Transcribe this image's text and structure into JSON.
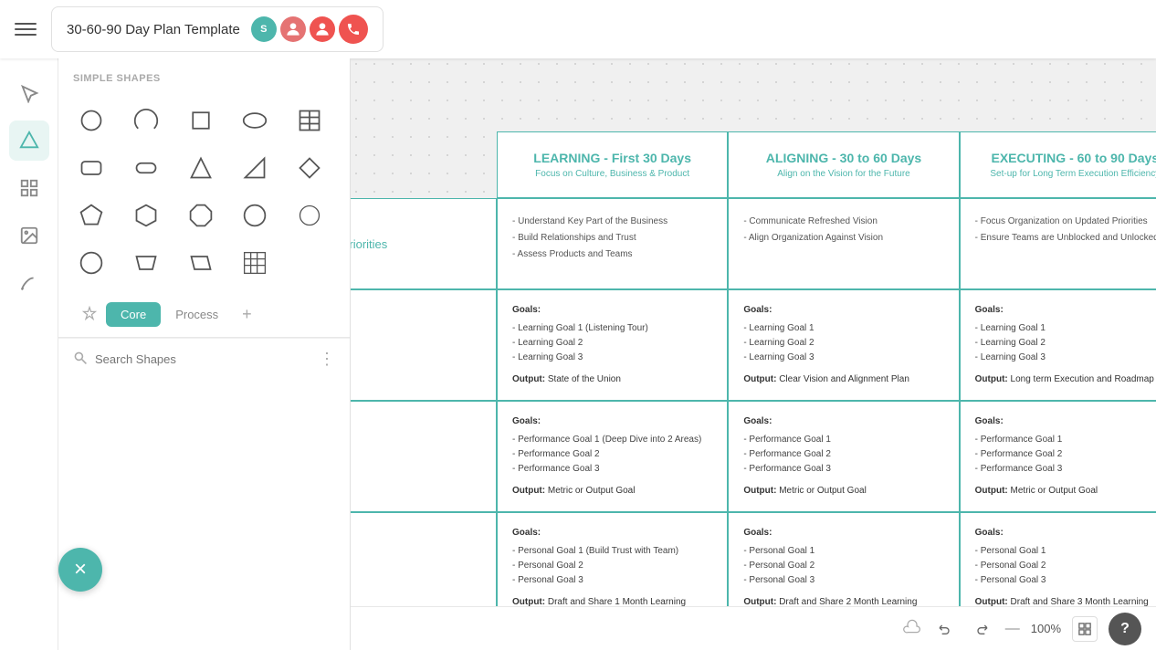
{
  "topbar": {
    "title": "30-60-90 Day Plan Template",
    "menu_icon": "☰",
    "avatars": [
      {
        "id": "s",
        "label": "S",
        "type": "letter"
      },
      {
        "id": "b",
        "label": "👤",
        "type": "image"
      },
      {
        "id": "c",
        "label": "👤",
        "type": "image"
      }
    ],
    "phone_icon": "📞"
  },
  "shapes_panel": {
    "header": "SIMPLE SHAPES",
    "tabs": [
      {
        "label": "Core",
        "active": true
      },
      {
        "label": "Process",
        "active": false
      }
    ],
    "search_placeholder": "Search Shapes"
  },
  "grid": {
    "columns": [
      {
        "title": "LEARNING - First 30 Days",
        "subtitle": "Focus on Culture, Business & Product"
      },
      {
        "title": "ALIGNING - 30 to 60 Days",
        "subtitle": "Align on the Vision for the Future"
      },
      {
        "title": "EXECUTING - 60 to 90 Days",
        "subtitle": "Set-up for Long Term Execution Efficiency"
      }
    ],
    "priorities_label": "Priorities",
    "priorities": [
      "- Understand Key Part of the Business\n- Build Relationships and Trust\n- Assess Products and Teams",
      "- Communicate Refreshed Vision\n- Align Organization Against Vision",
      "- Focus Organization on Updated Priorities\n- Ensure Teams are Unblocked and Unlocked"
    ],
    "sections": [
      {
        "label": "",
        "cells": [
          {
            "goals": "Goals:\n- Learning Goal 1 (Listening Tour)\n- Learning Goal 2\n- Learning Goal 3",
            "output": "Output: State of the Union"
          },
          {
            "goals": "Goals:\n- Learning Goal 1\n- Learning Goal 2\n- Learning Goal 3",
            "output": "Output: Clear Vision and Alignment Plan"
          },
          {
            "goals": "Goals:\n- Learning Goal 1\n- Learning Goal 2\n- Learning Goal 3",
            "output": "Output: Long term Execution and Roadmap"
          }
        ]
      },
      {
        "label": "",
        "cells": [
          {
            "goals": "Goals:\n- Performance Goal 1 (Deep Dive into 2 Areas)\n- Performance Goal 2\n- Performance Goal 3",
            "output": "Output: Metric or Output Goal"
          },
          {
            "goals": "Goals:\n- Performance Goal 1\n- Performance Goal 2\n- Performance Goal 3",
            "output": "Output: Metric or Output Goal"
          },
          {
            "goals": "Goals:\n- Performance Goal 1\n- Performance Goal 2\n- Performance Goal 3",
            "output": "Output: Metric or Output Goal"
          }
        ]
      },
      {
        "label": "",
        "cells": [
          {
            "goals": "Goals:\n- Personal Goal 1 (Build Trust with Team)\n- Personal Goal 2\n- Personal Goal 3",
            "output": "Output: Draft and Share 1 Month Learning"
          },
          {
            "goals": "Goals:\n- Personal Goal 1\n- Personal Goal 2\n- Personal Goal 3",
            "output": "Output: Draft and Share 2 Month Learning"
          },
          {
            "goals": "Goals:\n- Personal Goal 1\n- Personal Goal 2\n- Personal Goal 3",
            "output": "Output: Draft and Share 3 Month Learning"
          }
        ]
      }
    ]
  },
  "bottombar": {
    "zoom": "100%",
    "help": "?"
  }
}
